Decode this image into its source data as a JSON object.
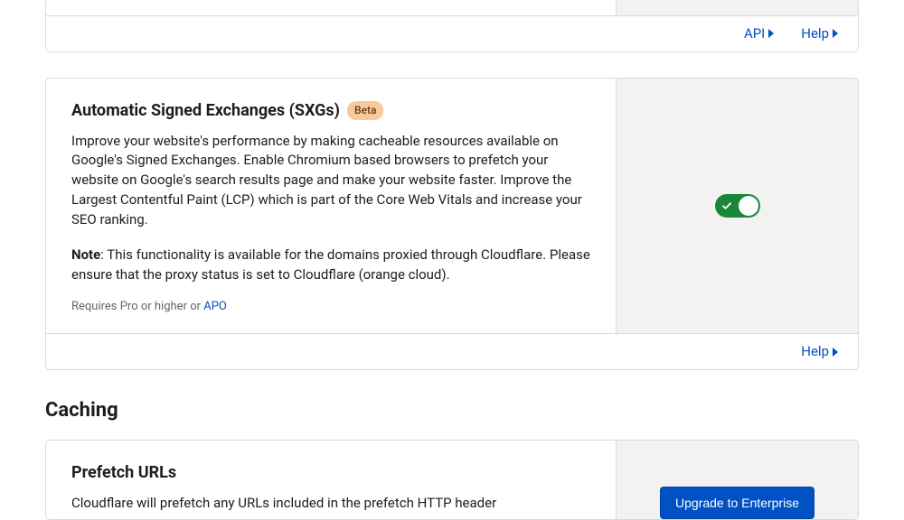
{
  "footer_links": {
    "api": "API",
    "help": "Help"
  },
  "sxg_card": {
    "title": "Automatic Signed Exchanges (SXGs)",
    "badge": "Beta",
    "description": "Improve your website's performance by making cacheable resources available on Google's Signed Exchanges. Enable Chromium based browsers to prefetch your website on Google's search results page and make your website faster. Improve the Largest Contentful Paint (LCP) which is part of the Core Web Vitals and increase your SEO ranking.",
    "note_label": "Note",
    "note_text": ": This functionality is available for the domains proxied through Cloudflare. Please ensure that the proxy status is set to Cloudflare (orange cloud).",
    "requires_prefix": "Requires Pro or higher or ",
    "requires_link": "APO",
    "toggle_on": true
  },
  "caching_section": {
    "heading": "Caching"
  },
  "prefetch_card": {
    "title": "Prefetch URLs",
    "description": "Cloudflare will prefetch any URLs included in the prefetch HTTP header",
    "cta": "Upgrade to Enterprise"
  }
}
